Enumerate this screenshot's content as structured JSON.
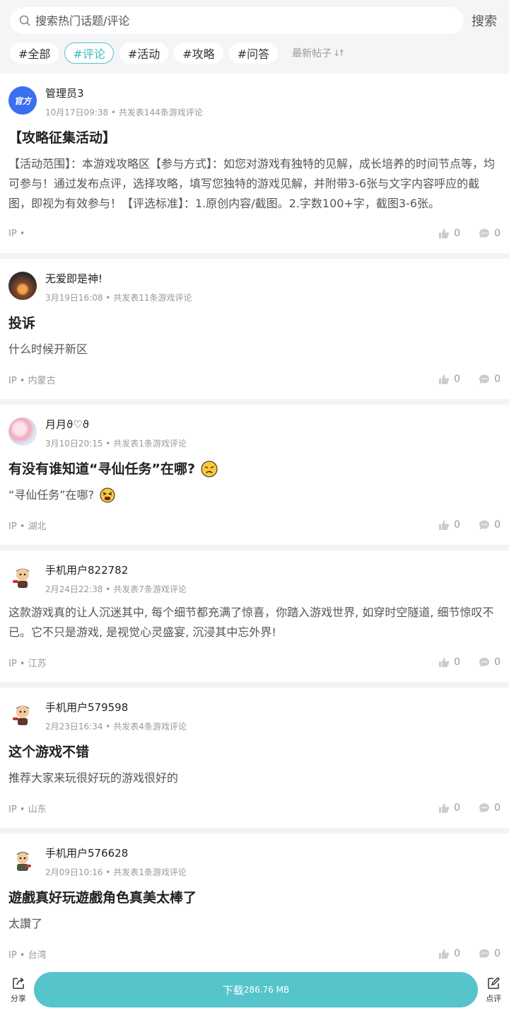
{
  "search": {
    "placeholder": "搜索热门话题/评论",
    "button_label": "搜索"
  },
  "tabs": [
    {
      "label": "#全部",
      "active": false
    },
    {
      "label": "#评论",
      "active": true
    },
    {
      "label": "#活动",
      "active": false
    },
    {
      "label": "#攻略",
      "active": false
    },
    {
      "label": "#问答",
      "active": false
    }
  ],
  "sort_label": "最新帖子",
  "posts": [
    {
      "user": "管理员3",
      "avatar_badge": "官方",
      "time": "10月17日09:38",
      "count_text": "共发表144条游戏评论",
      "title": "【攻略征集活动】",
      "body": "【活动范围】：本游戏攻略区【参与方式】：如您对游戏有独特的见解，成长培养的时间节点等，均可参与！通过发布点评，选择攻略，填写您独特的游戏见解，并附带3-6张与文字内容呼应的截图，即视为有效参与！【评选标准】：1.原创内容/截图。2.字数100+字，截图3-6张。",
      "ip": "IP •",
      "likes": "0",
      "comments": "0"
    },
    {
      "user": "无爱即是神!",
      "time": "3月19日16:08",
      "count_text": "共发表11条游戏评论",
      "title": "投诉",
      "body": "什么时候开新区",
      "ip": "IP • 内蒙古",
      "likes": "0",
      "comments": "0"
    },
    {
      "user": "月月ϑ♡ϑ",
      "time": "3月10日20:15",
      "count_text": "共发表1条游戏评论",
      "title": "有没有谁知道“寻仙任务”在哪?",
      "body": "“寻仙任务”在哪?",
      "ip": "IP • 湖北",
      "likes": "0",
      "comments": "0"
    },
    {
      "user": "手机用户822782",
      "time": "2月24日22:38",
      "count_text": "共发表7条游戏评论",
      "body": "这款游戏真的让人沉迷其中, 每个细节都充满了惊喜，你踏入游戏世界, 如穿时空隧道, 细节惊叹不已。它不只是游戏, 是视觉心灵盛宴, 沉浸其中忘外界!",
      "ip": "IP • 江苏",
      "likes": "0",
      "comments": "0"
    },
    {
      "user": "手机用户579598",
      "time": "2月23日16:34",
      "count_text": "共发表4条游戏评论",
      "title": "这个游戏不错",
      "body": "推荐大家来玩很好玩的游戏很好的",
      "ip": "IP • 山东",
      "likes": "0",
      "comments": "0"
    },
    {
      "user": "手机用户576628",
      "time": "2月09日10:16",
      "count_text": "共发表1条游戏评论",
      "title": "遊戲真好玩遊戲角色真美太棒了",
      "body": "太讚了",
      "ip": "IP • 台湾",
      "likes": "0",
      "comments": "0"
    }
  ],
  "bottom": {
    "share_label": "分享",
    "download_label": "下载",
    "download_size": "286.76 MB",
    "review_label": "点评"
  },
  "colors": {
    "accent": "#55c4cb",
    "active_tab": "#3fb5bd",
    "official_badge": "#3a6ff0"
  }
}
